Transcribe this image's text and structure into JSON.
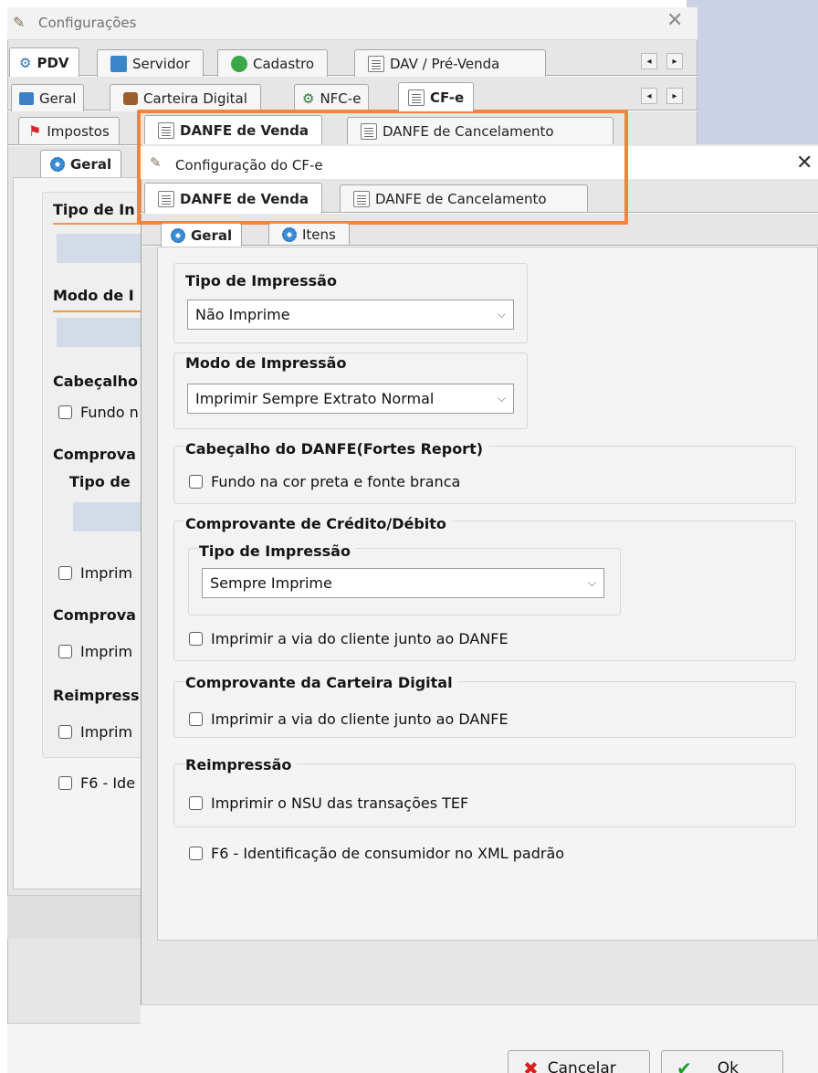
{
  "bg_window": {
    "title": "Configurações",
    "main_tabs": [
      "PDV",
      "Servidor",
      "Cadastro",
      "DAV / Pré-Venda"
    ],
    "sub_tabs": [
      "Geral",
      "Carteira Digital",
      "NFC-e",
      "CF-e"
    ],
    "sub_sub_tabs": [
      "Impostos",
      "DANFE de Venda",
      "DANFE de Cancelamento"
    ],
    "inner_tab": "Geral",
    "labels": [
      "Tipo de In",
      "Modo de I",
      "Cabeçalho",
      "Comprova",
      "Tipo de",
      "Comprova",
      "Reimpress"
    ],
    "checks": [
      "Fundo n",
      "Imprim",
      "Imprim",
      "Imprim",
      "F6 - Ide"
    ]
  },
  "dialog": {
    "title": "Configuração do CF-e",
    "top_tabs": [
      "DANFE de Venda",
      "DANFE de Cancelamento"
    ],
    "inner_tabs": [
      "Geral",
      "Itens"
    ],
    "tipo_impressao": {
      "label": "Tipo de Impressão",
      "value": "Não Imprime"
    },
    "modo_impressao": {
      "label": "Modo de Impressão",
      "value": "Imprimir Sempre Extrato Normal"
    },
    "cabecalho": {
      "label": "Cabeçalho do DANFE(Fortes Report)",
      "check": "Fundo na cor preta e fonte branca"
    },
    "comprovante_credito": {
      "label": "Comprovante de Crédito/Débito",
      "sub_label": "Tipo de Impressão",
      "value": "Sempre Imprime",
      "check": "Imprimir a via do cliente junto ao DANFE"
    },
    "comprovante_carteira": {
      "label": "Comprovante da Carteira Digital",
      "check": "Imprimir a via do cliente junto ao DANFE"
    },
    "reimpressao": {
      "label": "Reimpressão",
      "check": "Imprimir o NSU das transações TEF"
    },
    "f6_check": "F6 - Identificação de consumidor no XML padrão",
    "buttons": {
      "cancel": "Cancelar",
      "ok": "Ok"
    }
  },
  "colors": {
    "highlight": "#f5833a",
    "accent": "#3b8fd6"
  }
}
